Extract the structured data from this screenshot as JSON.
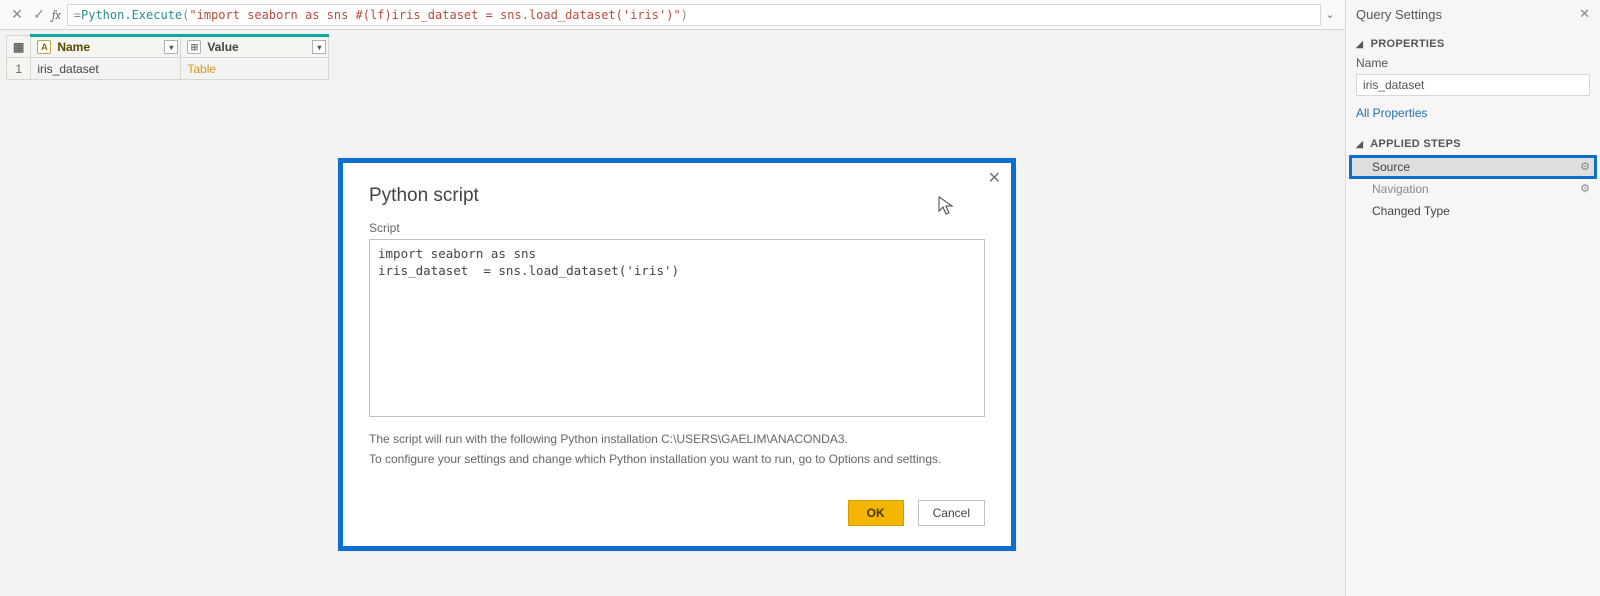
{
  "formula_bar": {
    "fx_label": "fx",
    "prefix": "= ",
    "fn": "Python.Execute",
    "open": "(",
    "string": "\"import seaborn as sns #(lf)iris_dataset  = sns.load_dataset('iris')\"",
    "close": ")"
  },
  "grid": {
    "columns": [
      {
        "header": "Name",
        "type_icon": "A"
      },
      {
        "header": "Value",
        "type_icon": "⊞"
      }
    ],
    "rows": [
      {
        "index": "1",
        "name": "iris_dataset",
        "value": "Table"
      }
    ]
  },
  "dialog": {
    "title": "Python script",
    "script_label": "Script",
    "script_value": "import seaborn as sns\niris_dataset  = sns.load_dataset('iris')",
    "info_line1": "The script will run with the following Python installation C:\\USERS\\GAELIM\\ANACONDA3.",
    "info_line2": "To configure your settings and change which Python installation you want to run, go to Options and settings.",
    "ok_label": "OK",
    "cancel_label": "Cancel"
  },
  "sidebar": {
    "title": "Query Settings",
    "properties_title": "PROPERTIES",
    "name_label": "Name",
    "name_value": "iris_dataset",
    "all_properties": "All Properties",
    "applied_steps_title": "APPLIED STEPS",
    "steps": [
      {
        "label": "Source",
        "selected": true,
        "highlight": true,
        "gear": true
      },
      {
        "label": "Navigation",
        "selected": false,
        "dim": true,
        "gear": true
      },
      {
        "label": "Changed Type",
        "selected": false
      }
    ]
  }
}
